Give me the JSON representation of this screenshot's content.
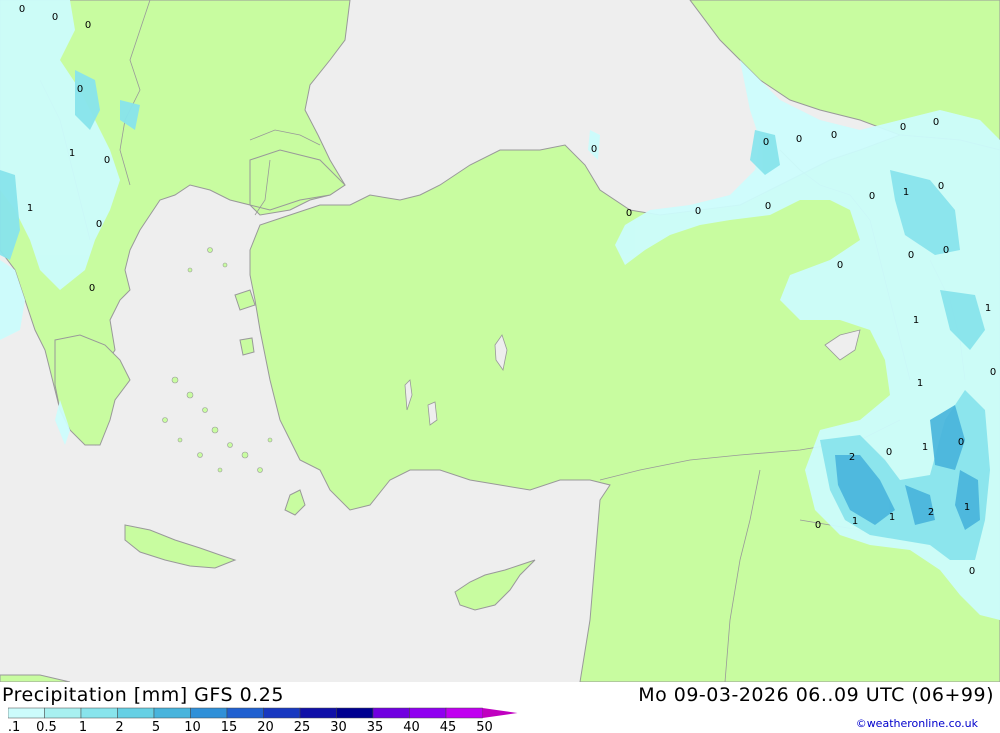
{
  "header": {
    "title": "Precipitation [mm] GFS 0.25",
    "timestamp": "Mo 09-03-2026 06..09 UTC (06+99)"
  },
  "credit": "©weatheronline.co.uk",
  "colors": {
    "sea": "#eeeeee",
    "land": "#c8fca0",
    "border": "#999999",
    "legend": [
      "#ccfcfc",
      "#a8f0f0",
      "#88e4ec",
      "#66d0e4",
      "#48b4dc",
      "#3090d8",
      "#2060d0",
      "#1838c0",
      "#1010a8",
      "#000090",
      "#7000e0",
      "#9000f0",
      "#c000f0",
      "#e000e8",
      "#c000c0",
      "#a000a0"
    ]
  },
  "legend": {
    "ticks": [
      "0.1",
      "0.5",
      "1",
      "2",
      "5",
      "10",
      "15",
      "20",
      "25",
      "30",
      "35",
      "40",
      "45",
      "50"
    ]
  },
  "map_labels": [
    "0",
    "0",
    "0",
    "0",
    "1",
    "0",
    "1",
    "0",
    "0",
    "0",
    "0",
    "0",
    "0",
    "0",
    "0",
    "0",
    "0",
    "0",
    "1",
    "0",
    "0",
    "0",
    "0",
    "1",
    "0",
    "1",
    "0",
    "2",
    "0",
    "1",
    "1",
    "0",
    "0",
    "1",
    "1",
    "2",
    "1",
    "0"
  ]
}
